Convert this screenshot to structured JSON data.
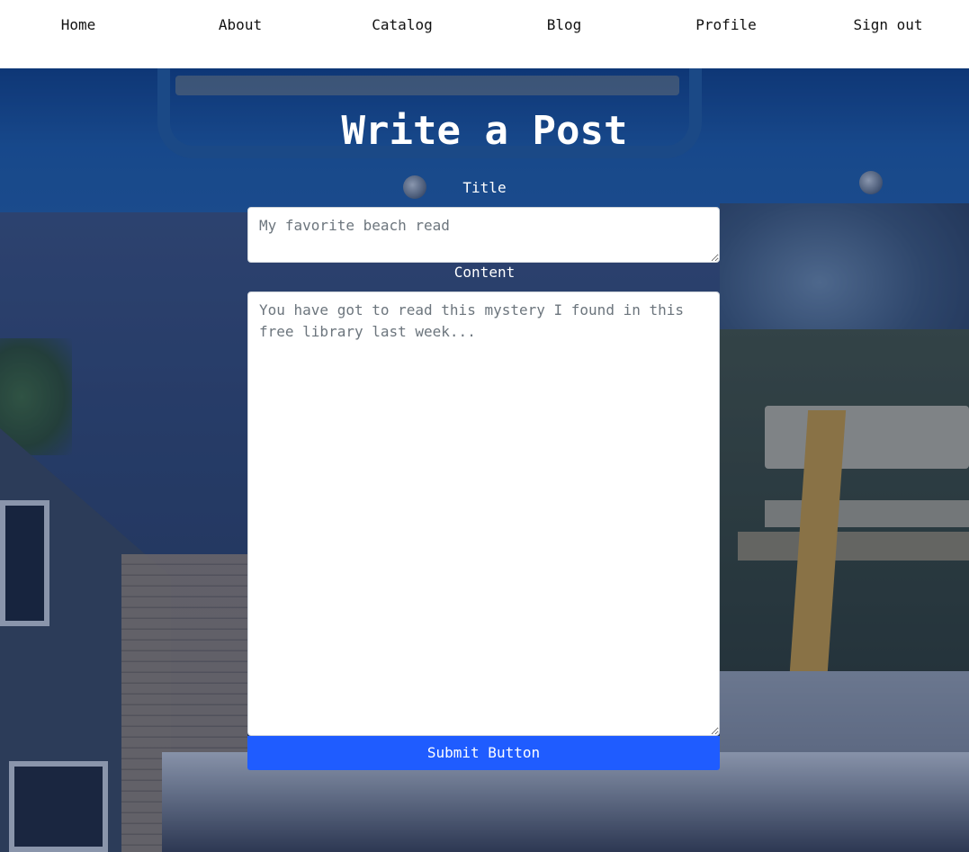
{
  "nav": {
    "items": [
      {
        "label": "Home"
      },
      {
        "label": "About"
      },
      {
        "label": "Catalog"
      },
      {
        "label": "Blog"
      },
      {
        "label": "Profile"
      },
      {
        "label": "Sign out"
      }
    ]
  },
  "form": {
    "heading": "Write a Post",
    "title_label": "Title",
    "title_placeholder": "My favorite beach read",
    "content_label": "Content",
    "content_placeholder": "You have got to read this mystery I found in this free library last week...",
    "submit_label": "Submit Button"
  },
  "colors": {
    "nav_background": "#ffffff",
    "submit_button": "#1f5cff",
    "heading_text": "#ffffff"
  }
}
